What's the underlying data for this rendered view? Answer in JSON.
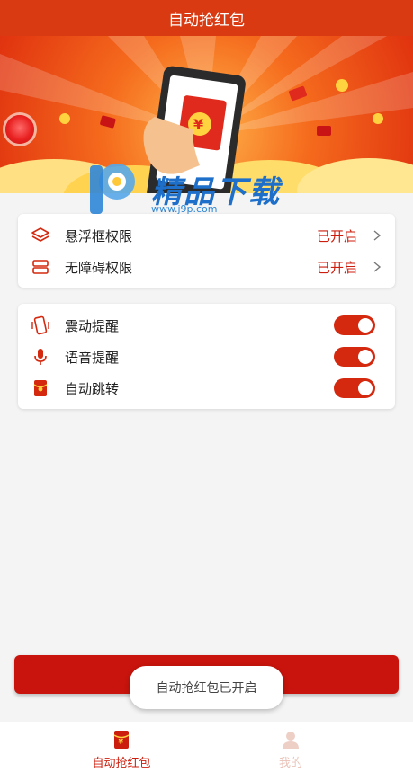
{
  "header": {
    "title": "自动抢红包"
  },
  "banner": {
    "envelope_symbol": "¥"
  },
  "watermark": {
    "brand": "精品下载",
    "url": "www.j9p.com"
  },
  "permissions": [
    {
      "label": "悬浮框权限",
      "status": "已开启",
      "icon": "layers-icon"
    },
    {
      "label": "无障碍权限",
      "status": "已开启",
      "icon": "accessibility-icon"
    }
  ],
  "settings": [
    {
      "label": "震动提醒",
      "enabled": true,
      "icon": "vibrate-phone-icon"
    },
    {
      "label": "语音提醒",
      "enabled": true,
      "icon": "microphone-icon"
    },
    {
      "label": "自动跳转",
      "enabled": true,
      "icon": "red-envelope-icon"
    }
  ],
  "toast": {
    "message": "自动抢红包已开启"
  },
  "tabbar": {
    "tabs": [
      {
        "label": "自动抢红包",
        "icon": "red-envelope-icon",
        "active": true
      },
      {
        "label": "我的",
        "icon": "user-icon",
        "active": false
      }
    ]
  },
  "colors": {
    "accent": "#d93a12",
    "button": "#c8140c"
  }
}
